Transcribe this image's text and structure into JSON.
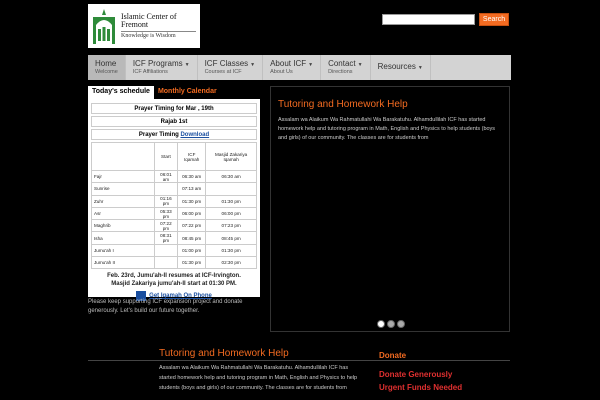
{
  "header": {
    "logo_name": "Islamic Center of Fremont",
    "logo_tagline": "Knowledge is Wisdom",
    "search_placeholder": "",
    "search_button": "Search"
  },
  "nav": {
    "items": [
      {
        "label": "Home",
        "sub": "Welcome",
        "caret": ""
      },
      {
        "label": "ICF Programs",
        "sub": "ICF Affiliations",
        "caret": "▼"
      },
      {
        "label": "ICF Classes",
        "sub": "Courses at ICF",
        "caret": "▼"
      },
      {
        "label": "About ICF",
        "sub": "About Us",
        "caret": "▼"
      },
      {
        "label": "Contact",
        "sub": "Directions",
        "caret": "▼"
      },
      {
        "label": "Resources",
        "sub": "",
        "caret": "▼"
      }
    ]
  },
  "schedule": {
    "tab_active": "Today's schedule",
    "tab_inactive": "Monthly Calendar",
    "heading": "Prayer Timing for Mar , 19th",
    "hijri": "Rajab 1st",
    "timing_label": "Prayer Timing",
    "download_label": "Download",
    "columns": [
      "",
      "Start",
      "ICF Iqamah",
      "Masjid Zakariya Iqamah"
    ],
    "rows": [
      {
        "name": "Fajr",
        "start": "06:01 am",
        "icf": "06:30 am",
        "mz": "06:30 am"
      },
      {
        "name": "Sunrise",
        "start": "",
        "icf": "07:13 am",
        "mz": ""
      },
      {
        "name": "Zuhr",
        "start": "01:16 pm",
        "icf": "01:30 pm",
        "mz": "01:30 pm"
      },
      {
        "name": "Asr",
        "start": "05:33 pm",
        "icf": "06:00 pm",
        "mz": "06:00 pm"
      },
      {
        "name": "Maghrib",
        "start": "07:22 pm",
        "icf": "07:22 pm",
        "mz": "07:23 pm"
      },
      {
        "name": "Isha",
        "start": "08:31 pm",
        "icf": "08:45 pm",
        "mz": "08:45 pm"
      },
      {
        "name": "Jumu'ah I",
        "start": "",
        "icf": "01:00 pm",
        "mz": "01:30 pm"
      },
      {
        "name": "Jumu'ah II",
        "start": "",
        "icf": "01:30 pm",
        "mz": "02:30 pm"
      }
    ],
    "note_line1": "Feb. 23rd, Jumu'ah-II resumes at ICF-Irvington.",
    "note_line2": "Masjid Zakariya jumu'ah-II start at 01:30 PM.",
    "phone_link": "Get Iqamah On Phone",
    "left_note": "Please keep supporting ICF expansion project and donate generously. Let's build our future together."
  },
  "slider": {
    "title": "Tutoring and Homework Help",
    "body": "Assalam wa Alaikum Wa Rahmatullahi Wa Barakatuhu. Alhamdullilah ICF has started homework help and tutoring program in Math, English and Physics to help students (boys and girls) of our community. The classes are for students from"
  },
  "bottom": {
    "title": "Tutoring and Homework Help",
    "text": "Assalam wa Alaikum Wa Rahmatullahi Wa Barakatuhu. Alhamdullilah ICF has started homework help and tutoring program in Math, English and Physics to help students (boys and girls) of our community. The classes are for students from",
    "donate_title": "Donate",
    "donate_links": [
      "Donate Generously",
      "Urgent Funds Needed"
    ]
  }
}
